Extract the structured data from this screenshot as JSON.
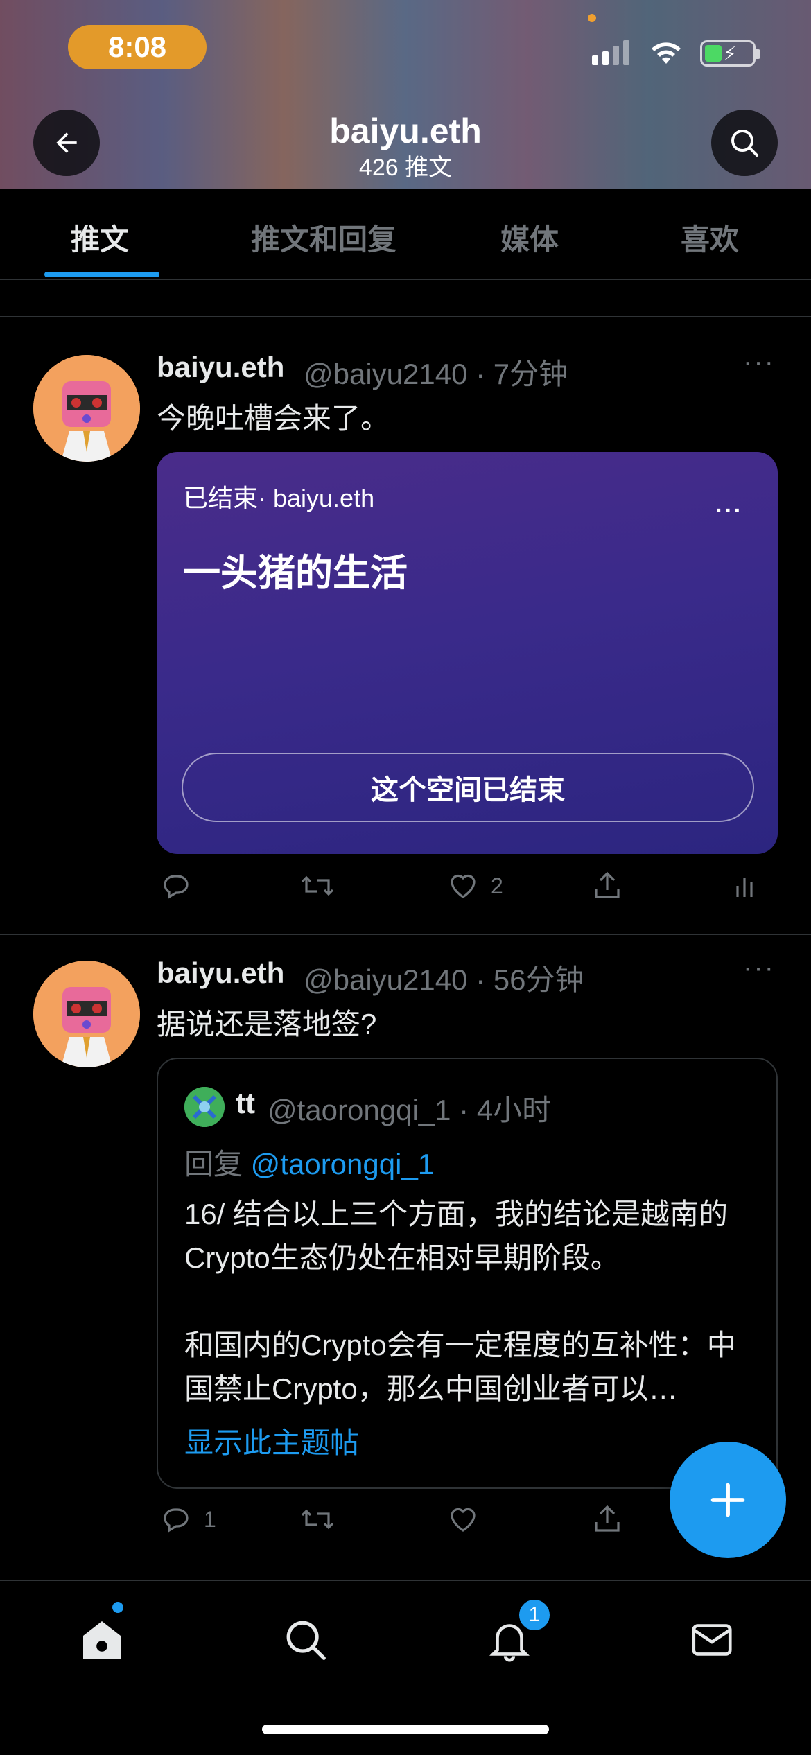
{
  "status_bar": {
    "time": "8:08"
  },
  "header": {
    "title": "baiyu.eth",
    "subtitle": "426 推文"
  },
  "tabs": [
    {
      "label": "推文",
      "active": true
    },
    {
      "label": "推文和回复",
      "active": false
    },
    {
      "label": "媒体",
      "active": false
    },
    {
      "label": "喜欢",
      "active": false
    }
  ],
  "tweets": [
    {
      "name": "baiyu.eth",
      "handle": "@baiyu2140 · 7分钟",
      "more": "···",
      "text": "今晚吐槽会来了。",
      "space": {
        "host": "已结束· baiyu.eth",
        "more": "···",
        "title": "一头猪的生活",
        "ended_label": "这个空间已结束"
      },
      "actions": {
        "reply_count": "",
        "retweet_count": "",
        "like_count": "2"
      }
    },
    {
      "name": "baiyu.eth",
      "handle": "@baiyu2140 · 56分钟",
      "more": "···",
      "text": "据说还是落地签?",
      "quote": {
        "name": "tt",
        "handle": "@taorongqi_1 · 4小时",
        "reply_prefix": "回复 ",
        "reply_mention": "@taorongqi_1",
        "body": "16/ 结合以上三个方面，我的结论是越南的Crypto生态仍处在相对早期阶段。\n\n和国内的Crypto会有一定程度的互补性：中国禁止Crypto，那么中国创业者可以…",
        "show_thread": "显示此主题帖"
      },
      "actions": {
        "reply_count": "1",
        "retweet_count": "",
        "like_count": ""
      }
    }
  ],
  "bottom_nav": {
    "notification_badge": "1"
  },
  "colors": {
    "accent": "#1d9bf0",
    "space_card": "#3a2a8a",
    "status_time_bg": "#e39a2a"
  }
}
